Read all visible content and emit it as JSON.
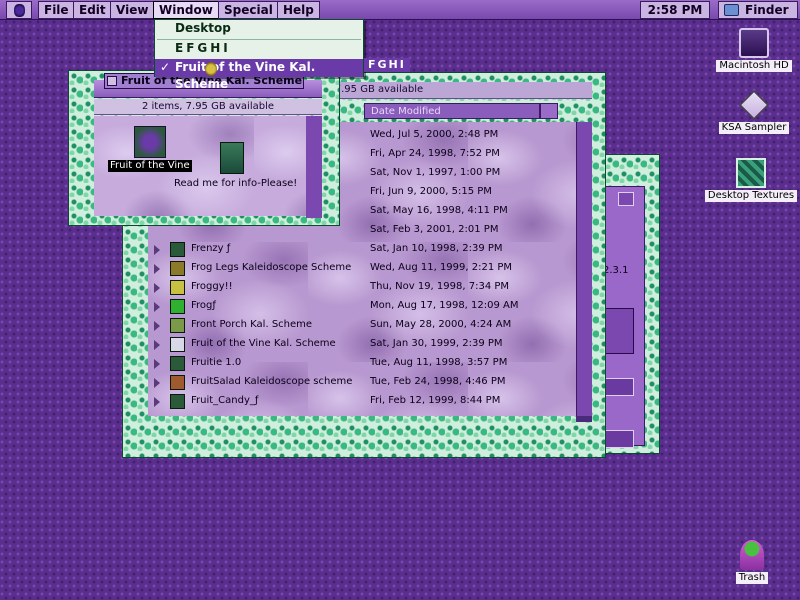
{
  "menubar": {
    "items": [
      "File",
      "Edit",
      "View",
      "Window",
      "Special",
      "Help"
    ],
    "clock": "2:58 PM",
    "app": "Finder"
  },
  "window_menu": {
    "items": [
      "Desktop",
      "EFGHI",
      "Fruit of the Vine Kal. Scheme"
    ],
    "checked": "✓",
    "tail": "FGHI"
  },
  "desktop": {
    "icons": [
      "Macintosh HD",
      "KSA Sampler",
      "Desktop Textures",
      "Trash"
    ]
  },
  "icon_window": {
    "title": "Fruit of the Vine Kal. Scheme",
    "info": "2 items, 7.95 GB available",
    "items": [
      "Fruit of the Vine",
      "Read me for info-Please!"
    ]
  },
  "list_window": {
    "info": "ns, 7.95 GB available",
    "date_header": "Date Modified",
    "rows": [
      {
        "name": "",
        "date": "Wed, Jul 5, 2000, 2:48 PM"
      },
      {
        "name": "",
        "date": "Fri, Apr 24, 1998, 7:52 PM"
      },
      {
        "name": "",
        "date": "Sat, Nov 1, 1997, 1:00 PM"
      },
      {
        "name": "",
        "date": "Fri, Jun 9, 2000, 5:15 PM"
      },
      {
        "name": "",
        "date": "Sat, May 16, 1998, 4:11 PM"
      },
      {
        "name": "",
        "date": "Sat, Feb 3, 2001, 2:01 PM"
      },
      {
        "name": "Frenzy ƒ",
        "date": "Sat, Jan 10, 1998, 2:39 PM"
      },
      {
        "name": "Frog Legs Kaleidoscope Scheme",
        "date": "Wed, Aug 11, 1999, 2:21 PM"
      },
      {
        "name": "Froggy!!",
        "date": "Thu, Nov 19, 1998, 7:34 PM"
      },
      {
        "name": "Frogƒ",
        "date": "Mon, Aug 17, 1998, 12:09 AM"
      },
      {
        "name": "Front Porch Kal. Scheme",
        "date": "Sun, May 28, 2000, 4:24 AM"
      },
      {
        "name": "Fruit of the Vine Kal. Scheme",
        "date": "Sat, Jan 30, 1999, 2:39 PM"
      },
      {
        "name": "Fruitie 1.0",
        "date": "Tue, Aug 11, 1998, 3:57 PM"
      },
      {
        "name": "FruitSalad  Kaleidoscope scheme",
        "date": "Tue, Feb 24, 1998, 4:46 PM"
      },
      {
        "name": "Fruit_Candy_ƒ",
        "date": "Fri, Feb 12, 1999, 8:44 PM"
      }
    ]
  },
  "back_window": {
    "version": "2.3.1"
  }
}
